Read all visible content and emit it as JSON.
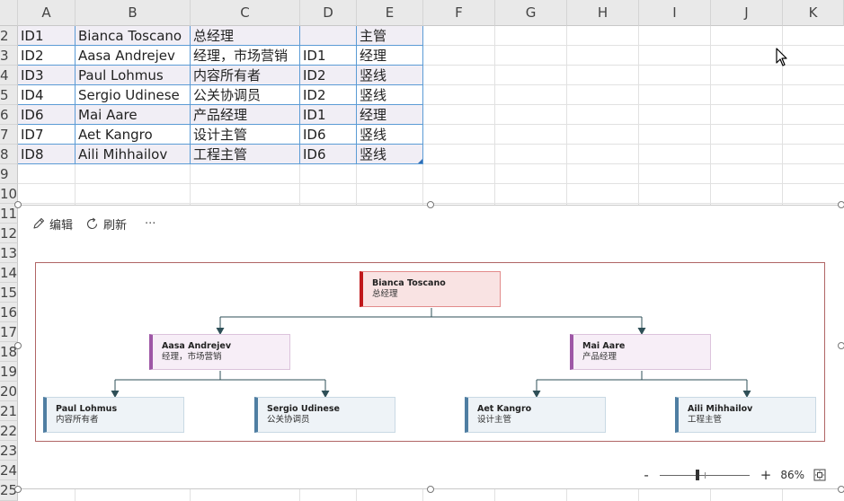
{
  "sheet": {
    "columns": [
      "A",
      "B",
      "C",
      "D",
      "E",
      "F",
      "G",
      "H",
      "I",
      "J",
      "K"
    ],
    "rows": [
      "2",
      "3",
      "4",
      "5",
      "6",
      "7",
      "8",
      "9",
      "10",
      "11",
      "12",
      "13",
      "14",
      "15",
      "16",
      "17",
      "18",
      "19",
      "20",
      "21",
      "22",
      "23",
      "24",
      "25"
    ],
    "table_rows": [
      {
        "a": "ID1",
        "b": "Bianca Toscano",
        "c": "总经理",
        "d": "",
        "e": "主管"
      },
      {
        "a": "ID2",
        "b": "Aasa Andrejev",
        "c": "经理，市场营销",
        "d": "ID1",
        "e": "经理"
      },
      {
        "a": "ID3",
        "b": "Paul Lohmus",
        "c": "内容所有者",
        "d": "ID2",
        "e": "竖线"
      },
      {
        "a": "ID4",
        "b": "Sergio Udinese",
        "c": "公关协调员",
        "d": "ID2",
        "e": "竖线"
      },
      {
        "a": "ID6",
        "b": "Mai Aare",
        "c": "产品经理",
        "d": "ID1",
        "e": "经理"
      },
      {
        "a": "ID7",
        "b": "Aet Kangro",
        "c": "设计主管",
        "d": "ID6",
        "e": "竖线"
      },
      {
        "a": "ID8",
        "b": "Aili Mihhailov",
        "c": "工程主管",
        "d": "ID6",
        "e": "竖线"
      }
    ]
  },
  "toolbar": {
    "edit_label": "编辑",
    "refresh_label": "刷新",
    "more_label": "···",
    "edit_icon": "pencil-icon",
    "refresh_icon": "refresh-icon"
  },
  "orgchart": {
    "root": {
      "name": "Bianca Toscano",
      "title": "总经理"
    },
    "managers": [
      {
        "name": "Aasa Andrejev",
        "title": "经理，市场营销",
        "reports": [
          {
            "name": "Paul Lohmus",
            "title": "内容所有者"
          },
          {
            "name": "Sergio Udinese",
            "title": "公关协调员"
          }
        ]
      },
      {
        "name": "Mai Aare",
        "title": "产品经理",
        "reports": [
          {
            "name": "Aet Kangro",
            "title": "设计主管"
          },
          {
            "name": "Aili Mihhailov",
            "title": "工程主管"
          }
        ]
      }
    ],
    "colors": {
      "root_accent": "#c0181b",
      "manager_accent": "#9e57a6",
      "leaf_accent": "#4f7ea2",
      "connector": "#2e4f57",
      "frame": "#b06565"
    }
  },
  "zoom": {
    "minus": "-",
    "plus": "+",
    "level": "86%",
    "level_fraction": 0.86,
    "fit_icon": "fit-to-window-icon"
  }
}
